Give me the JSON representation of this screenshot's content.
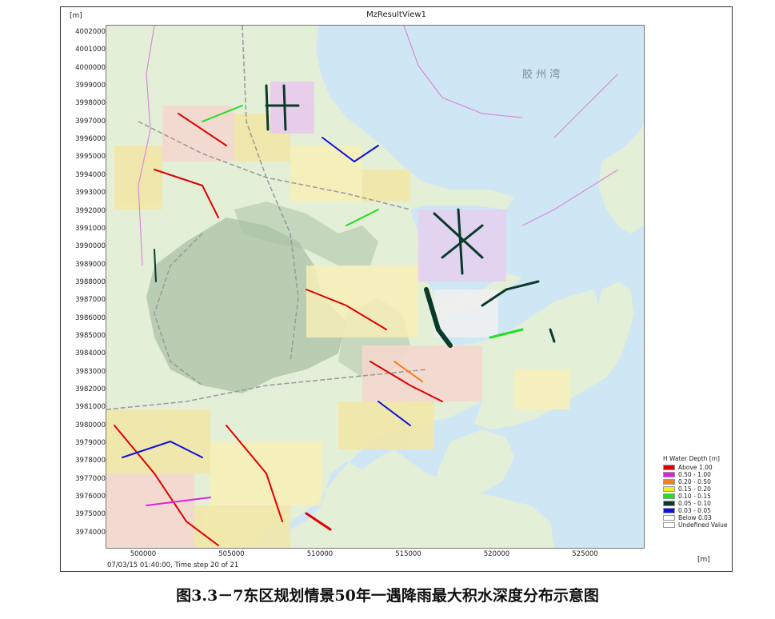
{
  "window": {
    "title": "MzResultView1"
  },
  "axes": {
    "y_unit": "[m]",
    "x_unit": "[m]",
    "y_ticks": [
      "4002000",
      "4001000",
      "4000000",
      "3999000",
      "3998000",
      "3997000",
      "3996000",
      "3995000",
      "3994000",
      "3993000",
      "3992000",
      "3991000",
      "3990000",
      "3989000",
      "3988000",
      "3987000",
      "3986000",
      "3985000",
      "3984000",
      "3983000",
      "3982000",
      "3981000",
      "3980000",
      "3979000",
      "3978000",
      "3977000",
      "3976000",
      "3975000",
      "3974000"
    ],
    "x_ticks": [
      "500000",
      "505000",
      "510000",
      "515000",
      "520000",
      "525000"
    ]
  },
  "status": {
    "timestep": "07/03/15 01:40:00, Time step 20 of 21"
  },
  "map": {
    "place_labels": {
      "bay": "胶 州 湾"
    },
    "colors": {
      "sea": "#cfe6f5",
      "land": "#e4efd8",
      "hills": "#a9c2a6"
    }
  },
  "legend": {
    "title": "H Water Depth [m]",
    "items": [
      {
        "label": "Above 1.00",
        "color": "#e00000"
      },
      {
        "label": "0.50 - 1.00",
        "color": "#e020e0"
      },
      {
        "label": "0.20 - 0.50",
        "color": "#f08020"
      },
      {
        "label": "0.15 - 0.20",
        "color": "#f0f020"
      },
      {
        "label": "0.10 - 0.15",
        "color": "#20e020"
      },
      {
        "label": "0.05 - 0.10",
        "color": "#0a3a2a"
      },
      {
        "label": "0.03 - 0.05",
        "color": "#1010e0"
      },
      {
        "label": "Below 0.03",
        "color": "#ffffff"
      },
      {
        "label": "Undefined Value",
        "color": "#ffffff"
      }
    ]
  },
  "caption": "图3.3－7东区规划情景50年一遇降雨最大积水深度分布示意图"
}
